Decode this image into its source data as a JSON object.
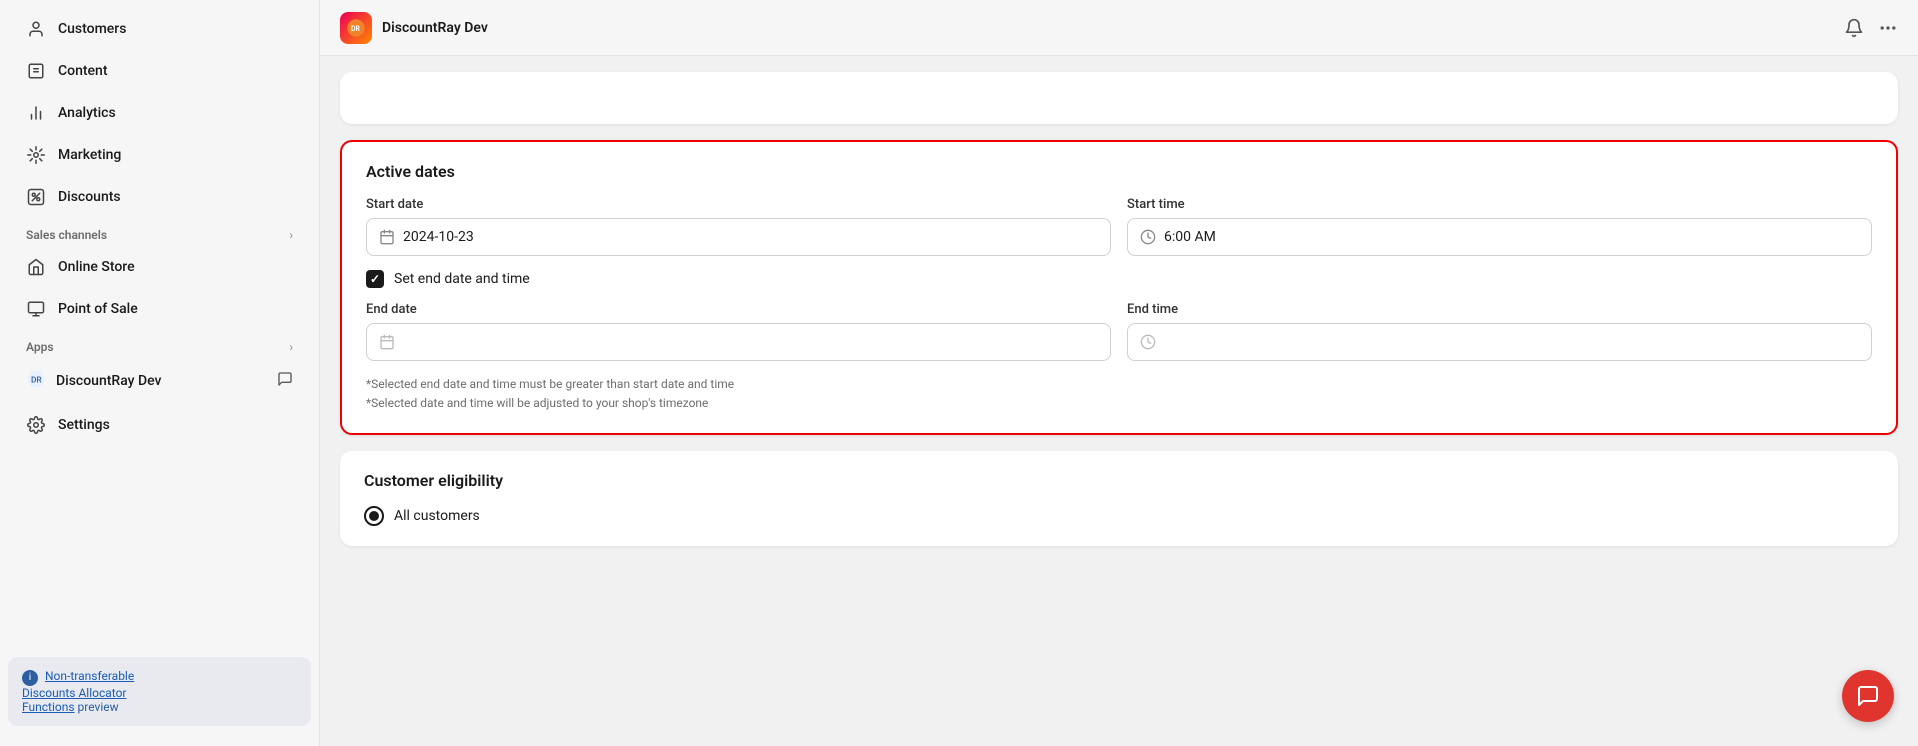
{
  "sidebar": {
    "items": [
      {
        "id": "customers",
        "label": "Customers",
        "icon": "👤"
      },
      {
        "id": "content",
        "label": "Content",
        "icon": "📄"
      },
      {
        "id": "analytics",
        "label": "Analytics",
        "icon": "📊"
      },
      {
        "id": "marketing",
        "label": "Marketing",
        "icon": "⚙"
      },
      {
        "id": "discounts",
        "label": "Discounts",
        "icon": "🏷"
      }
    ],
    "sales_channels_label": "Sales channels",
    "sales_channels": [
      {
        "id": "online-store",
        "label": "Online Store",
        "icon": "🏪"
      },
      {
        "id": "point-of-sale",
        "label": "Point of Sale",
        "icon": "💳"
      }
    ],
    "apps_label": "Apps",
    "apps": [
      {
        "id": "discountray-dev",
        "label": "DiscountRay Dev",
        "icon": "🔵"
      }
    ],
    "settings_label": "Settings",
    "footer_info": "Non-transferable Discounts Allocator Functions preview"
  },
  "topbar": {
    "title": "DiscountRay Dev",
    "bell_icon": "🔔",
    "more_icon": "···"
  },
  "active_dates": {
    "section_title": "Active dates",
    "start_date_label": "Start date",
    "start_date_value": "2024-10-23",
    "start_time_label": "Start time",
    "start_time_value": "6:00 AM",
    "set_end_label": "Set end date and time",
    "end_date_label": "End date",
    "end_date_placeholder": "",
    "end_time_label": "End time",
    "end_time_placeholder": "",
    "hint1": "*Selected end date and time must be greater than start date and time",
    "hint2": "*Selected date and time will be adjusted to your shop's timezone"
  },
  "customer_eligibility": {
    "section_title": "Customer eligibility",
    "option_label": "All customers"
  }
}
